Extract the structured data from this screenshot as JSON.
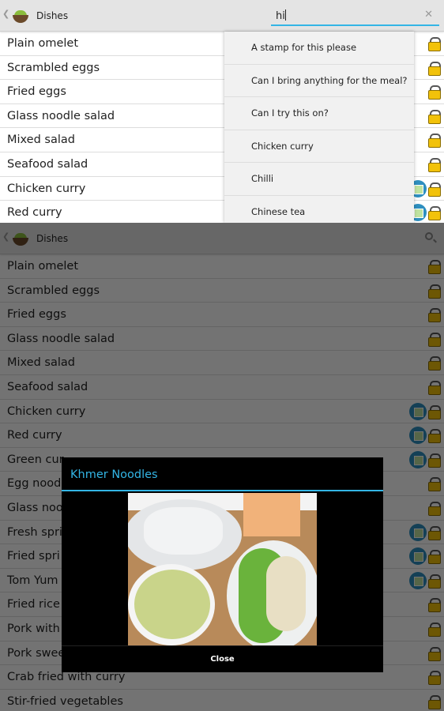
{
  "app": {
    "title": "Dishes",
    "accent": "#33b5e5"
  },
  "search": {
    "value": "hi"
  },
  "top_list": [
    {
      "label": "Plain omelet",
      "photo": false
    },
    {
      "label": "Scrambled eggs",
      "photo": false
    },
    {
      "label": "Fried eggs",
      "photo": false
    },
    {
      "label": "Glass noodle salad",
      "photo": false
    },
    {
      "label": "Mixed salad",
      "photo": false
    },
    {
      "label": "Seafood salad",
      "photo": false
    },
    {
      "label": "Chicken curry",
      "photo": true
    },
    {
      "label": "Red curry",
      "photo": true
    }
  ],
  "suggestions": [
    "A stamp for this  please",
    "Can I bring anything for the meal?",
    "Can I try this on?",
    "Chicken curry",
    "Chilli",
    "Chinese tea"
  ],
  "bottom_list": [
    {
      "label": "Plain omelet",
      "photo": false
    },
    {
      "label": "Scrambled eggs",
      "photo": false
    },
    {
      "label": "Fried eggs",
      "photo": false
    },
    {
      "label": "Glass noodle salad",
      "photo": false
    },
    {
      "label": "Mixed salad",
      "photo": false
    },
    {
      "label": "Seafood salad",
      "photo": false
    },
    {
      "label": "Chicken curry",
      "photo": true
    },
    {
      "label": "Red curry",
      "photo": true
    },
    {
      "label": "Green cur",
      "photo": true
    },
    {
      "label": "Egg noodl",
      "photo": false
    },
    {
      "label": "Glass noo",
      "photo": false
    },
    {
      "label": "Fresh spri",
      "photo": true
    },
    {
      "label": "Fried spri",
      "photo": true
    },
    {
      "label": "Tom Yum",
      "photo": true
    },
    {
      "label": "Fried rice",
      "photo": false
    },
    {
      "label": "Pork with",
      "photo": false
    },
    {
      "label": "Pork swee",
      "photo": false
    },
    {
      "label": "Crab fried with curry",
      "photo": false
    },
    {
      "label": "Stir-fried vegetables",
      "photo": false
    }
  ],
  "dialog": {
    "title": "Khmer Noodles",
    "close_label": "Close"
  }
}
